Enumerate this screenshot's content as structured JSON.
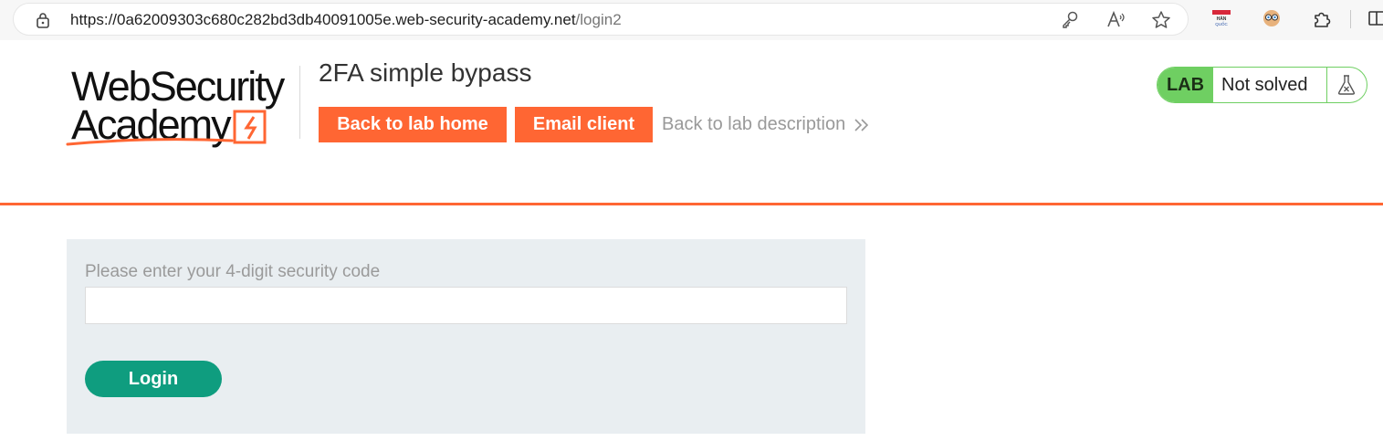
{
  "browser": {
    "url_host": "https://0a62009303c680c282bd3db40091005e.web-security-academy.net",
    "url_path": "/login2",
    "extension_badge_label": "HÀN QUỐC"
  },
  "header": {
    "logo_line1": "WebSecurity",
    "logo_line2": "Academy",
    "lab_title": "2FA simple bypass",
    "back_home_label": "Back to lab home",
    "email_client_label": "Email client",
    "back_description_label": "Back to lab description"
  },
  "lab_status": {
    "tag": "LAB",
    "status": "Not solved"
  },
  "form": {
    "label": "Please enter your 4-digit security code",
    "code_value": "",
    "login_label": "Login"
  },
  "colors": {
    "brand_orange": "#ff6633",
    "lab_green": "#6fcf62",
    "login_teal": "#0f9d7f",
    "panel_bg": "#e9eef1"
  },
  "icons": [
    "lock-icon",
    "key-icon",
    "read-aloud-icon",
    "favorite-star-icon",
    "hanquoc-extension-icon",
    "profile-extension-icon",
    "puzzle-extensions-icon",
    "split-screen-icon",
    "double-chevron-right-icon",
    "flask-icon",
    "logo-lightning-icon"
  ]
}
